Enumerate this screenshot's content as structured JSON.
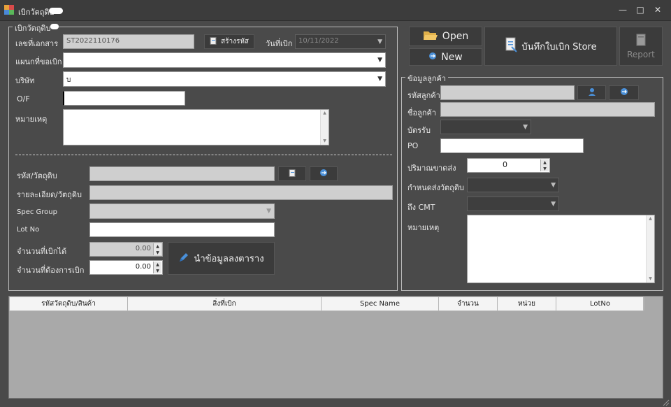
{
  "window": {
    "title": "เบิกวัตถุดิบ"
  },
  "issue_group": {
    "title": "เบิกวัตถุดิบ",
    "doc_no_label": "เลขที่เอกสาร",
    "doc_no_value": "ST2022110176",
    "create_code_label": "สร้างรหัส",
    "date_label": "วันที่เบิก",
    "date_value": "10/11/2022",
    "dept_label": "แผนกที่ขอเบิก",
    "company_label": "บริษัท",
    "company_value": "บ",
    "of_label": "O/F",
    "of_value": "",
    "remark_label": "หมายเหตุ",
    "material_code_label": "รหัส/วัตถุดิบ",
    "material_detail_label": "รายละเอียด/วัตถุดิบ",
    "spec_group_label": "Spec Group",
    "lot_no_label": "Lot No",
    "qty_available_label": "จำนวนที่เบิกได้",
    "qty_available_value": "0.00",
    "qty_request_label": "จำนวนที่ต้องการเบิก",
    "qty_request_value": "0.00",
    "add_to_table_label": "นำข้อมูลลงตาราง"
  },
  "toolbar": {
    "open_label": "Open",
    "new_label": "New",
    "save_label": "บันทึกใบเบิก Store",
    "report_label": "Report"
  },
  "customer_group": {
    "title": "ข้อมูลลูกค้า",
    "customer_code_label": "รหัสลูกค้า",
    "customer_name_label": "ชื่อลูกค้า",
    "card_label": "บัตรรับ",
    "po_label": "PO",
    "po_value": "",
    "shortage_label": "ปริมาณขาดส่ง",
    "shortage_value": "0",
    "due_label": "กำหนดส่งวัตถุดิบ",
    "cmt_label": "ถึง CMT",
    "remark_label": "หมายเหตุ"
  },
  "table": {
    "columns": [
      "รหัสวัตถุดิบ/สินค้า",
      "สิ่งที่เบิก",
      "Spec Name",
      "จำนวน",
      "หน่วย",
      "LotNo"
    ]
  },
  "colors": {
    "background": "#4a4a4a",
    "grid_body": "#a9a9a9",
    "accent_icon": "#4a90d9"
  }
}
